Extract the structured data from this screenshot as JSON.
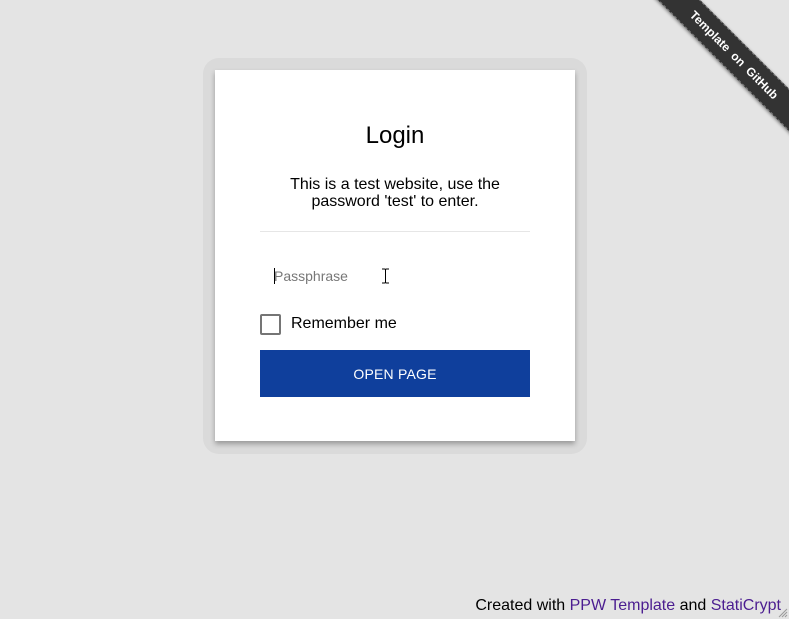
{
  "ribbon": {
    "label": "Template on GitHub"
  },
  "login": {
    "title": "Login",
    "instructions": "This is a test website, use the password 'test' to enter.",
    "passphrase_placeholder": "Passphrase",
    "passphrase_value": "",
    "remember_label": "Remember me",
    "remember_checked": false,
    "submit_label": "OPEN PAGE"
  },
  "footer": {
    "prefix": "Created with ",
    "link1": "PPW Template",
    "middle": " and ",
    "link2": "StatiCrypt"
  },
  "colors": {
    "background": "#e4e4e4",
    "card": "#ffffff",
    "button": "#0f3f9c",
    "button_text": "#ffffff",
    "link": "#4b1d90",
    "ribbon": "#333333"
  },
  "icons": {
    "cursor": "text-cursor-icon",
    "grip": "resize-grip-icon"
  }
}
